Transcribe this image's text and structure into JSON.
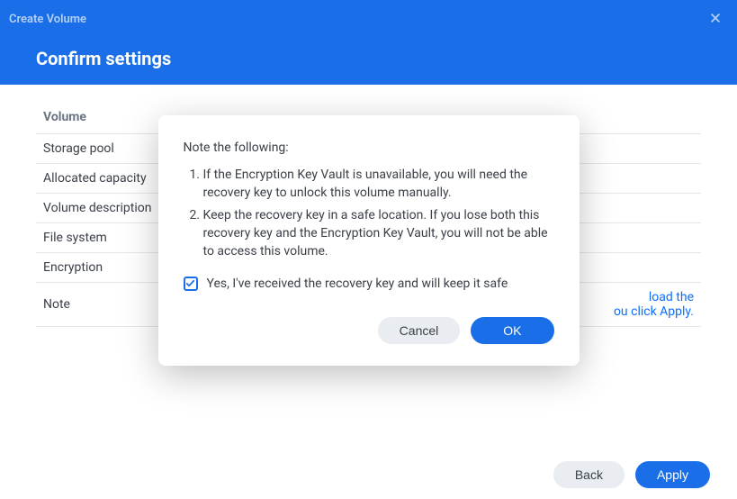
{
  "window": {
    "title": "Create Volume"
  },
  "header": {
    "title": "Confirm settings"
  },
  "table": {
    "header": "Volume",
    "rows": [
      {
        "label": "Storage pool"
      },
      {
        "label": "Allocated capacity"
      },
      {
        "label": "Volume description"
      },
      {
        "label": "File system"
      },
      {
        "label": "Encryption"
      },
      {
        "label": "Note"
      }
    ],
    "noteLinkPart1": "load the",
    "noteLinkPart2": "ou click Apply."
  },
  "dialog": {
    "heading": "Note the following:",
    "item1": "If the Encryption Key Vault is unavailable, you will need the recovery key to unlock this volume manually.",
    "item2": "Keep the recovery key in a safe location. If you lose both this recovery key and the Encryption Key Vault, you will not be able to access this volume.",
    "checkboxLabel": "Yes, I've received the recovery key and will keep it safe",
    "cancel": "Cancel",
    "ok": "OK"
  },
  "footer": {
    "back": "Back",
    "apply": "Apply"
  }
}
